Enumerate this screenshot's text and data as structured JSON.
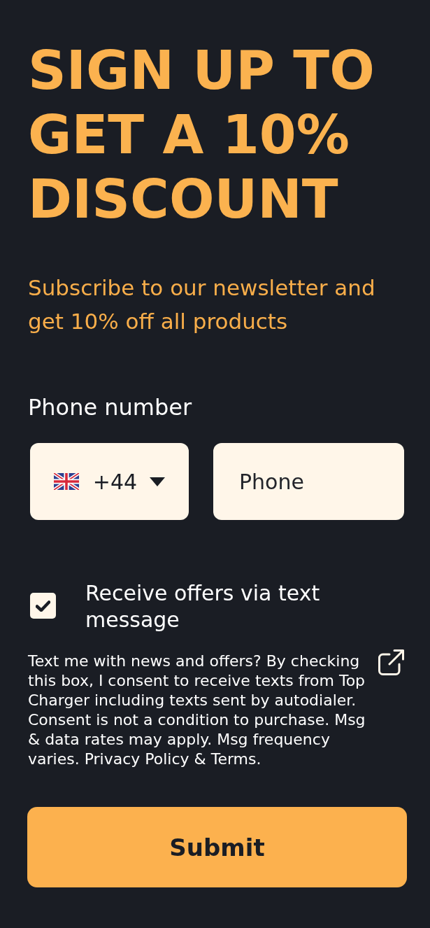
{
  "heading": "SIGN UP TO GET A 10% DISCOUNT",
  "subtitle": "Subscribe to our newsletter and get 10% off all products",
  "phone": {
    "label": "Phone number",
    "country_code": "+44",
    "placeholder": "Phone"
  },
  "consent": {
    "label": "Receive offers via text message",
    "checked": true,
    "disclaimer": "Text me with news and offers? By checking this box, I consent to receive texts from Top Charger including texts sent by autodialer. Consent is not a condition to purchase. Msg & data rates may apply. Msg frequency varies. Privacy Policy & Terms."
  },
  "submit": {
    "label": "Submit"
  }
}
